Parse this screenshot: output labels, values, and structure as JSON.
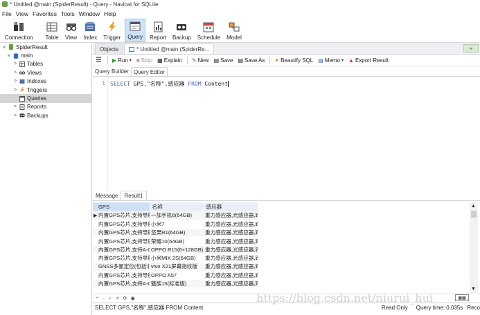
{
  "window": {
    "title": "* Untitled @main (SpiderResult) - Query - Navicat for SQLite"
  },
  "menu": [
    "File",
    "View",
    "Favorites",
    "Tools",
    "Window",
    "Help"
  ],
  "toolbar": {
    "items": [
      {
        "label": "Connection",
        "icon": "plug-icon"
      },
      {
        "label": "Table",
        "icon": "table-icon"
      },
      {
        "label": "View",
        "icon": "glasses-icon"
      },
      {
        "label": "Index",
        "icon": "index-icon"
      },
      {
        "label": "Trigger",
        "icon": "lightning-icon"
      },
      {
        "label": "Query",
        "icon": "query-icon"
      },
      {
        "label": "Report",
        "icon": "report-icon"
      },
      {
        "label": "Backup",
        "icon": "backup-icon"
      },
      {
        "label": "Schedule",
        "icon": "calendar-icon"
      },
      {
        "label": "Model",
        "icon": "model-icon"
      }
    ],
    "active": "Query"
  },
  "sidebar": {
    "connection": "SpiderResult",
    "database": "main",
    "items": [
      {
        "label": "Tables",
        "icon": "tables-icon"
      },
      {
        "label": "Views",
        "icon": "views-icon"
      },
      {
        "label": "Indexes",
        "icon": "indexes-icon"
      },
      {
        "label": "Triggers",
        "icon": "triggers-icon"
      },
      {
        "label": "Queries",
        "icon": "queries-icon",
        "selected": true
      },
      {
        "label": "Reports",
        "icon": "reports-icon"
      },
      {
        "label": "Backups",
        "icon": "backups-icon"
      }
    ]
  },
  "tabs": {
    "objects": "Objects",
    "query_tab": "* Untitled @main (SpiderRe..."
  },
  "query_toolbar": {
    "run": "Run",
    "stop": "Stop",
    "explain": "Explain",
    "new": "New",
    "save": "Save",
    "save_as": "Save As",
    "beautify": "Beautify SQL",
    "memo": "Memo",
    "export": "Export Result"
  },
  "subtabs": {
    "builder": "Query Builder",
    "editor": "Query Editor"
  },
  "editor": {
    "line_number": "1",
    "select_kw": "SELECT",
    "fields": " GPS,\"名称\",感应器 ",
    "from_kw": "FROM",
    "table": " Content"
  },
  "result_tabs": {
    "message": "Message",
    "result": "Result1"
  },
  "results": {
    "columns": [
      "GPS",
      "名称",
      "感应器"
    ],
    "rows": [
      [
        "内置GPS芯片,支持导航",
        "一加手机6(64GB)",
        "重力感应器,光感应器,距离感应器"
      ],
      [
        "内置GPS芯片,支持导航",
        "小米7",
        "重力感应器,光感应器,距离感应器"
      ],
      [
        "内置GPS芯片,支持导航",
        "坚果R1(64GB)",
        "重力感应器,光感应器,距离感应器"
      ],
      [
        "内置GPS芯片,支持导航",
        "荣耀10(64GB)",
        "重力感应器,光感应器,距离感应器"
      ],
      [
        "内置GPS芯片,支持A-GPS",
        "OPPO R15(6+128GB)",
        "重力感应器,光感应器,距离感应器"
      ],
      [
        "内置GPS芯片,支持导航",
        "小米MIX 2S(64GB)",
        "重力感应器,光感应器,距离感应器"
      ],
      [
        "GNSS多星定位(包括北斗)",
        "vivo X21屏幕指纹版",
        "重力感应器,光感应器,距离感应器"
      ],
      [
        "内置GPS芯片,支持导航",
        "OPPO A57",
        "重力感应器,光感应器,距离感应器"
      ],
      [
        "内置GPS芯片,支持A-GPS",
        "魅族15(标准版)",
        "重力感应器,光感应器,距离感应器"
      ]
    ]
  },
  "status": {
    "sql": "SELECT GPS,\"名称\",感应器 FROM Content",
    "mode": "Read Only",
    "query_time": "Query time: 0.035s",
    "record": "Reco"
  },
  "watermark": "https://blog.csdn.net/niurui_hui"
}
